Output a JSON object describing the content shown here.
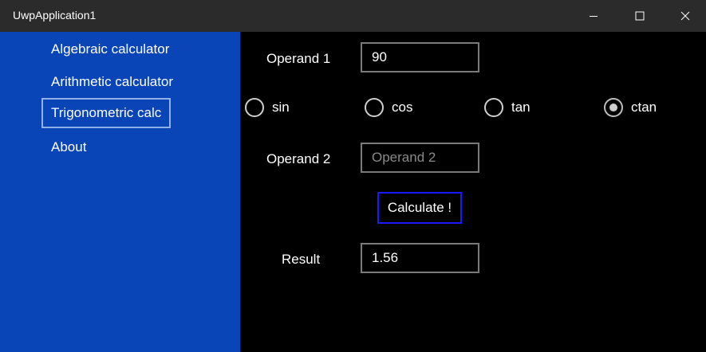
{
  "window": {
    "title": "UwpApplication1"
  },
  "nav": {
    "items": [
      {
        "label": "Algebraic calculator"
      },
      {
        "label": "Arithmetic calculator"
      },
      {
        "label": "Trigonometric calc",
        "selected": true
      },
      {
        "label": "About"
      }
    ]
  },
  "form": {
    "operand1_label": "Operand 1",
    "operand1_value": "90",
    "operand2_label": "Operand 2",
    "operand2_placeholder": "Operand 2",
    "operand2_value": "",
    "functions": [
      {
        "label": "sin",
        "checked": false
      },
      {
        "label": "cos",
        "checked": false
      },
      {
        "label": "tan",
        "checked": false
      },
      {
        "label": "ctan",
        "checked": true
      }
    ],
    "calculate_label": "Calculate !",
    "result_label": "Result",
    "result_value": "1.56"
  },
  "colors": {
    "sidebar": "#0a45b8",
    "titlebar": "#2b2b2b",
    "button_border": "#1a1aff"
  },
  "icons": {
    "minimize": "minimize-icon",
    "maximize": "maximize-icon",
    "close": "close-icon"
  }
}
